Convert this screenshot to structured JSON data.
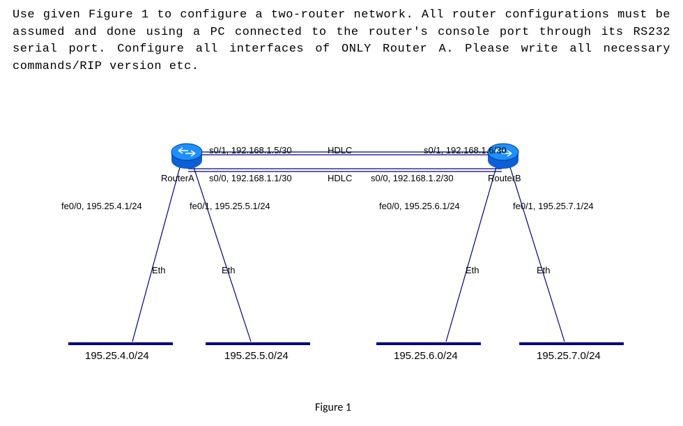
{
  "question": "Use given Figure 1 to configure a two-router network. All router configurations must be assumed and done using a PC connected to the router's console port through its RS232 serial port. Configure all interfaces of ONLY Router A. Please write all necessary commands/RIP version etc.",
  "routers": {
    "A": {
      "name": "RouterA",
      "interfaces": {
        "s0_1": {
          "label": "s0/1, 192.168.1.5/30",
          "ip": "192.168.1.5",
          "mask": "/30"
        },
        "s0_0": {
          "label": "s0/0, 192.168.1.1/30",
          "ip": "192.168.1.1",
          "mask": "/30"
        },
        "fe0_0": {
          "label": "fe0/0, 195.25.4.1/24",
          "ip": "195.25.4.1",
          "mask": "/24"
        },
        "fe0_1": {
          "label": "fe0/1, 195.25.5.1/24",
          "ip": "195.25.5.1",
          "mask": "/24"
        }
      }
    },
    "B": {
      "name": "RouterB",
      "interfaces": {
        "s0_1": {
          "label": "s0/1, 192.168.1.6/30",
          "ip": "192.168.1.6",
          "mask": "/30"
        },
        "s0_0": {
          "label": "s0/0, 192.168.1.2/30",
          "ip": "192.168.1.2",
          "mask": "/30"
        },
        "fe0_0": {
          "label": "fe0/0, 195.25.6.1/24",
          "ip": "195.25.6.1",
          "mask": "/24"
        },
        "fe0_1": {
          "label": "fe0/1, 195.25.7.1/24",
          "ip": "195.25.7.1",
          "mask": "/24"
        }
      }
    }
  },
  "links": {
    "serial": {
      "protocol": "HDLC",
      "label_top": "HDLC",
      "label_bottom": "HDLC"
    },
    "ethernet_label": "Eth"
  },
  "networks": {
    "n1": "195.25.4.0/24",
    "n2": "195.25.5.0/24",
    "n3": "195.25.6.0/24",
    "n4": "195.25.7.0/24"
  },
  "figure_caption": "Figure 1",
  "chart_data": {
    "type": "table",
    "title": "Two-router network topology (Figure 1)",
    "routers": [
      {
        "name": "RouterA",
        "interfaces": [
          {
            "name": "s0/1",
            "ip": "192.168.1.5/30",
            "link": "HDLC to RouterB s0/1"
          },
          {
            "name": "s0/0",
            "ip": "192.168.1.1/30",
            "link": "HDLC to RouterB s0/0"
          },
          {
            "name": "fe0/0",
            "ip": "195.25.4.1/24",
            "link": "Eth to 195.25.4.0/24"
          },
          {
            "name": "fe0/1",
            "ip": "195.25.5.1/24",
            "link": "Eth to 195.25.5.0/24"
          }
        ]
      },
      {
        "name": "RouterB",
        "interfaces": [
          {
            "name": "s0/1",
            "ip": "192.168.1.6/30",
            "link": "HDLC to RouterA s0/1"
          },
          {
            "name": "s0/0",
            "ip": "192.168.1.2/30",
            "link": "HDLC to RouterA s0/0"
          },
          {
            "name": "fe0/0",
            "ip": "195.25.6.1/24",
            "link": "Eth to 195.25.6.0/24"
          },
          {
            "name": "fe0/1",
            "ip": "195.25.7.1/24",
            "link": "Eth to 195.25.7.0/24"
          }
        ]
      }
    ],
    "lan_segments": [
      "195.25.4.0/24",
      "195.25.5.0/24",
      "195.25.6.0/24",
      "195.25.7.0/24"
    ]
  }
}
